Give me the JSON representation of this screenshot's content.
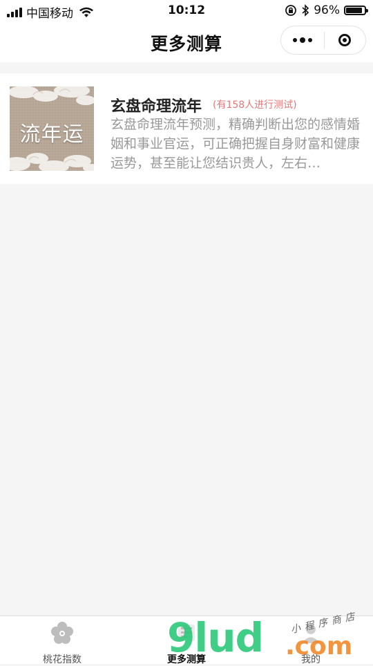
{
  "status_bar": {
    "carrier": "中国移动",
    "time": "10:12",
    "battery": "96%",
    "battery_level": 0.96,
    "icons": [
      "signal-icon",
      "wifi-icon",
      "rotation-lock-icon",
      "bluetooth-icon",
      "battery-icon"
    ]
  },
  "nav": {
    "title": "更多测算",
    "capsule": [
      "more-icon",
      "close-target-icon"
    ]
  },
  "list": {
    "items": [
      {
        "thumbnail_text": "流年运",
        "title": "玄盘命理流年",
        "count_text": "(有158人进行测试)",
        "description": "玄盘命理流年预测，精确判断出您的感情婚姻和事业官运，可正确把握自身财富和健康运势，甚至能让您结识贵人，左右…"
      }
    ]
  },
  "tabbar": {
    "tabs": [
      {
        "label": "桃花指数",
        "icon": "blossom-icon",
        "active": false
      },
      {
        "label": "更多测算",
        "icon": "more-calc-icon",
        "active": true
      },
      {
        "label": "我的",
        "icon": "user-icon",
        "active": false
      }
    ]
  },
  "watermark": {
    "main": "9lud",
    "dotcom": ".com",
    "sub": "小程序商店"
  },
  "colors": {
    "accent_count": "#e07a7a",
    "page_bg": "#f5f5f5",
    "watermark_green": "#2cc97a",
    "watermark_orange": "#f28a2a"
  }
}
